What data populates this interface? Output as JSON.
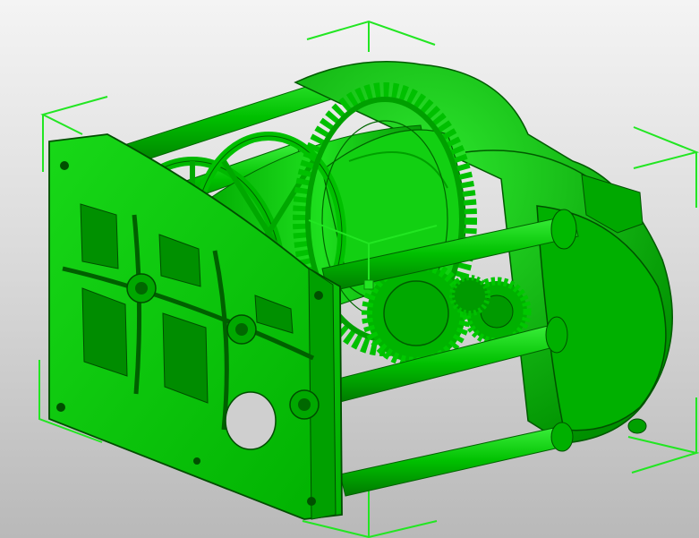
{
  "viewport": {
    "background_top": "#f4f4f4",
    "background_bottom": "#b9b9b9"
  },
  "model": {
    "color": "#00c800",
    "shade_dark": "#007a00",
    "shade_light": "#4ef04e",
    "edge_color": "#004d00"
  },
  "bounding_box": {
    "color": "#22e622"
  },
  "gizmo": {
    "color": "#22e622",
    "center_marker": "square"
  }
}
